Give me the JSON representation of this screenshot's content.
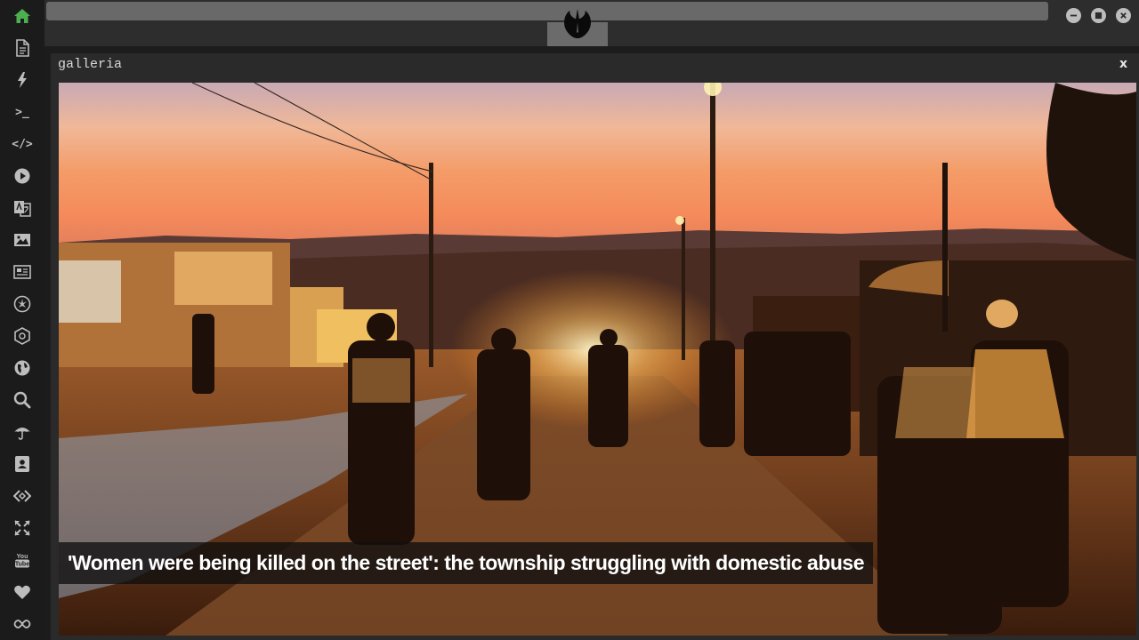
{
  "colors": {
    "accent_home": "#4caf50",
    "sidebar_bg": "#1b1b1b",
    "icon": "#bdbdbd",
    "panel_bg": "#2a2a2a"
  },
  "sidebar": {
    "items": [
      {
        "icon": "home-icon"
      },
      {
        "icon": "document-icon"
      },
      {
        "icon": "lightning-icon"
      },
      {
        "icon": "terminal-icon",
        "label": ">_"
      },
      {
        "icon": "code-icon",
        "label": "</>"
      },
      {
        "icon": "play-icon"
      },
      {
        "icon": "translate-icon"
      },
      {
        "icon": "image-icon"
      },
      {
        "icon": "newspaper-icon"
      },
      {
        "icon": "rebel-icon"
      },
      {
        "icon": "empire-icon"
      },
      {
        "icon": "globe-icon"
      },
      {
        "icon": "search-icon"
      },
      {
        "icon": "umbrella-icon"
      },
      {
        "icon": "contact-icon"
      },
      {
        "icon": "code-fork-icon"
      },
      {
        "icon": "expand-icon"
      },
      {
        "icon": "youtube-icon",
        "label": "You Tube"
      },
      {
        "icon": "heart-icon"
      },
      {
        "icon": "infinity-icon"
      }
    ]
  },
  "window": {
    "logo": "rebel-alliance-logo"
  },
  "gallery": {
    "title": "galleria",
    "close_label": "x",
    "caption": "'Women were being killed on the street': the township struggling with domestic abuse"
  }
}
